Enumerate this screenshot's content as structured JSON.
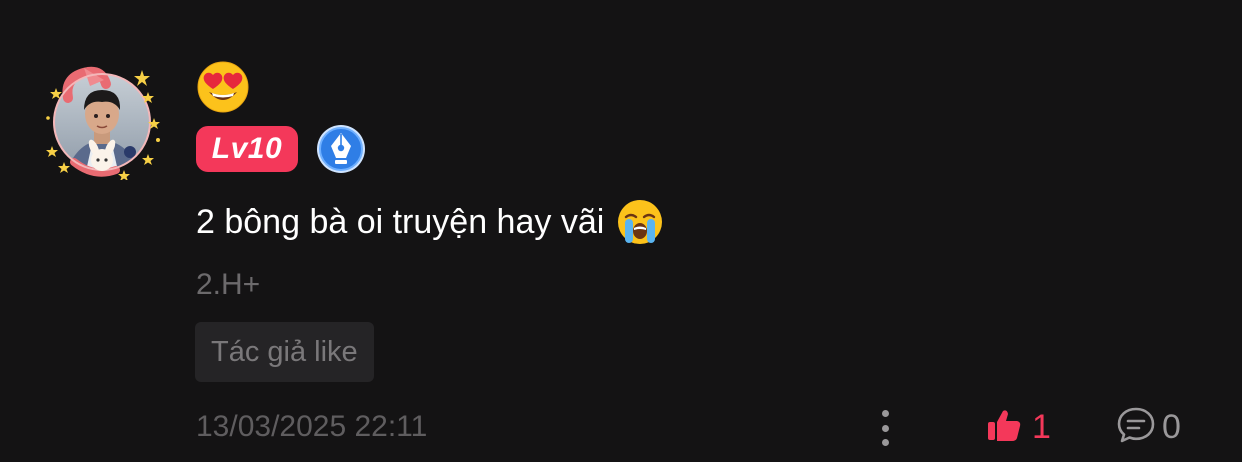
{
  "user": {
    "avatar_icon": "avatar-photo-heart-frame",
    "name_emoji": "😍",
    "level_label": "Lv10",
    "level_color": "#f4385a",
    "author_badge_icon": "pen-nib-badge-icon"
  },
  "comment": {
    "text": "2 bông bà oi truyện hay vãi",
    "text_emoji": "😭",
    "chapter": "2.H+",
    "author_like_label": "Tác giả like",
    "timestamp": "13/03/2025 22:11"
  },
  "actions": {
    "more_icon": "more-vertical-icon",
    "like_icon": "thumbs-up-icon",
    "like_count": "1",
    "like_color": "#f4385a",
    "reply_icon": "comment-bubble-icon",
    "reply_count": "0"
  }
}
